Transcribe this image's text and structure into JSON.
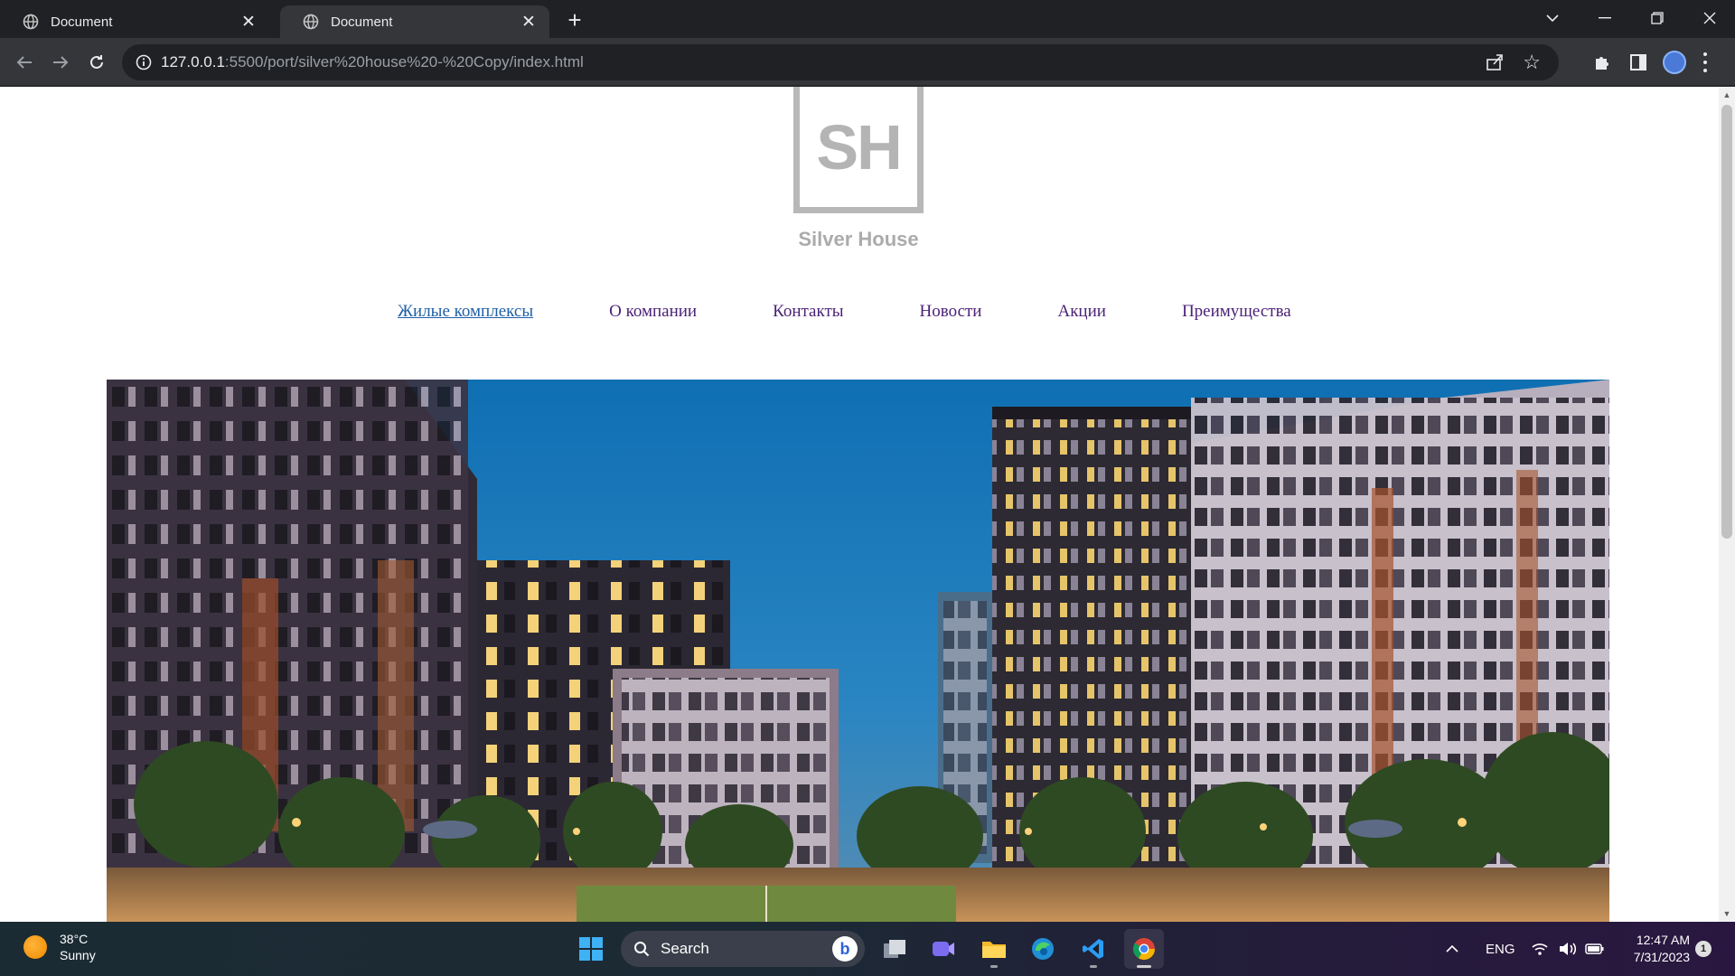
{
  "browser": {
    "tabs": [
      {
        "title": "Document",
        "active": false
      },
      {
        "title": "Document",
        "active": true
      }
    ],
    "url_host": "127.0.0.1",
    "url_rest": ":5500/port/silver%20house%20-%20Copy/index.html"
  },
  "page": {
    "logo_mono": "SH",
    "brand_name": "Silver House",
    "nav": [
      {
        "label": "Жилые комплексы",
        "current": true
      },
      {
        "label": "О компании",
        "current": false
      },
      {
        "label": "Контакты",
        "current": false
      },
      {
        "label": "Новости",
        "current": false
      },
      {
        "label": "Акции",
        "current": false
      },
      {
        "label": "Преимущества",
        "current": false
      }
    ]
  },
  "taskbar": {
    "weather_temp": "38°C",
    "weather_condition": "Sunny",
    "search_placeholder": "Search",
    "language": "ENG",
    "time": "12:47 AM",
    "date": "7/31/2023",
    "notification_count": "1"
  },
  "colors": {
    "nav_link": "#4b2276",
    "nav_current": "#1f5fa6",
    "logo_gray": "#b4b4b4"
  }
}
